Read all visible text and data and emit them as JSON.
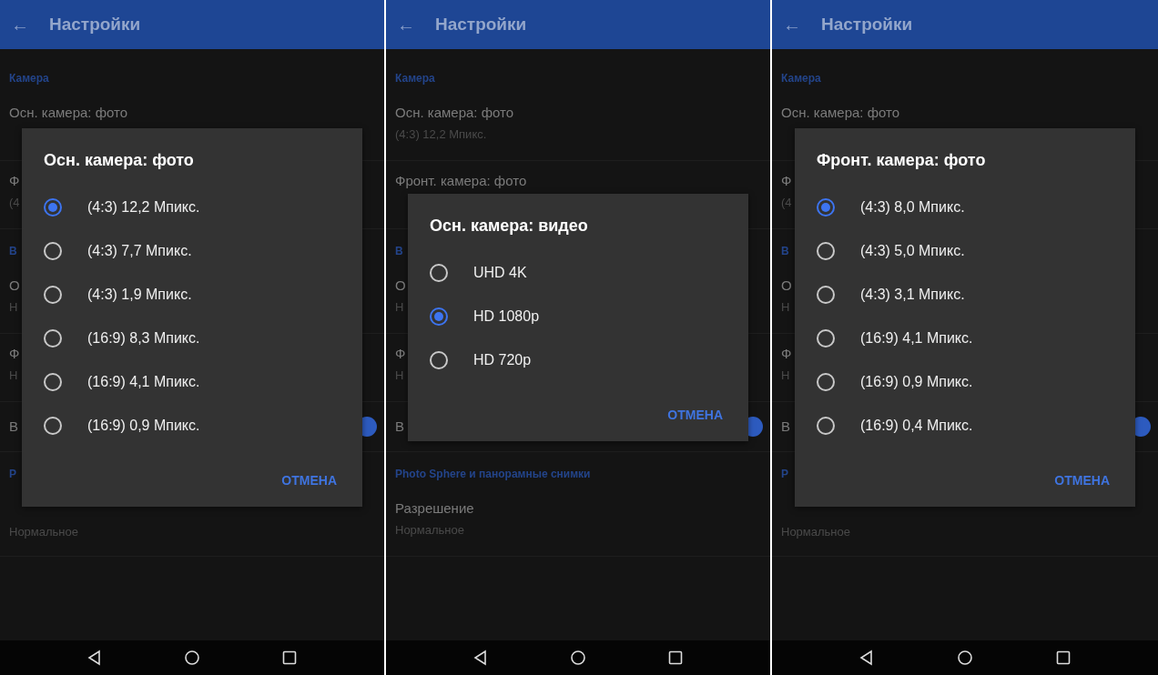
{
  "panels": [
    {
      "app_bar": {
        "back": "←",
        "title": "Настройки"
      },
      "settings": [
        {
          "kind": "header",
          "text": "Камера"
        },
        {
          "kind": "item",
          "title": "Осн. камера: фото"
        },
        {
          "kind": "item",
          "title": "Ф",
          "subtitle": "(4"
        },
        {
          "kind": "header",
          "text": "В"
        },
        {
          "kind": "item",
          "title": "О",
          "subtitle": "Н"
        },
        {
          "kind": "item",
          "title": "Ф",
          "subtitle": "Н"
        },
        {
          "kind": "switch",
          "title": "В",
          "on": true
        },
        {
          "kind": "header",
          "text": "Р"
        },
        {
          "kind": "item",
          "subtitle": "Нормальное"
        }
      ],
      "dialog": {
        "title": "Осн. камера: фото",
        "options": [
          {
            "label": "(4:3) 12,2 Мпикс.",
            "selected": true
          },
          {
            "label": "(4:3) 7,7 Мпикс.",
            "selected": false
          },
          {
            "label": "(4:3) 1,9 Мпикс.",
            "selected": false
          },
          {
            "label": "(16:9) 8,3 Мпикс.",
            "selected": false
          },
          {
            "label": "(16:9) 4,1 Мпикс.",
            "selected": false
          },
          {
            "label": "(16:9) 0,9 Мпикс.",
            "selected": false
          }
        ],
        "cancel": "ОТМЕНА"
      }
    },
    {
      "app_bar": {
        "back": "←",
        "title": "Настройки"
      },
      "settings": [
        {
          "kind": "header",
          "text": "Камера"
        },
        {
          "kind": "item",
          "title": "Осн. камера: фото",
          "subtitle": "(4:3) 12,2 Мпикс."
        },
        {
          "kind": "item",
          "title": "Фронт. камера: фото"
        },
        {
          "kind": "header",
          "text": "В"
        },
        {
          "kind": "item",
          "title": "О",
          "subtitle": "Н"
        },
        {
          "kind": "item",
          "title": "Ф",
          "subtitle": "Н"
        },
        {
          "kind": "switch",
          "title": "В",
          "on": true
        },
        {
          "kind": "header",
          "text": "Photo Sphere и панорамные снимки"
        },
        {
          "kind": "item",
          "title": "Разрешение",
          "subtitle": "Нормальное"
        }
      ],
      "dialog": {
        "title": "Осн. камера: видео",
        "options": [
          {
            "label": "UHD 4K",
            "selected": false
          },
          {
            "label": "HD 1080p",
            "selected": true
          },
          {
            "label": "HD 720p",
            "selected": false
          }
        ],
        "cancel": "ОТМЕНА"
      }
    },
    {
      "app_bar": {
        "back": "←",
        "title": "Настройки"
      },
      "settings": [
        {
          "kind": "header",
          "text": "Камера"
        },
        {
          "kind": "item",
          "title": "Осн. камера: фото"
        },
        {
          "kind": "item",
          "title": "Ф",
          "subtitle": "(4"
        },
        {
          "kind": "header",
          "text": "В"
        },
        {
          "kind": "item",
          "title": "О",
          "subtitle": "Н"
        },
        {
          "kind": "item",
          "title": "Ф",
          "subtitle": "Н"
        },
        {
          "kind": "switch",
          "title": "В",
          "on": true
        },
        {
          "kind": "header",
          "text": "Р"
        },
        {
          "kind": "item",
          "subtitle": "Нормальное"
        }
      ],
      "dialog": {
        "title": "Фронт. камера: фото",
        "options": [
          {
            "label": "(4:3) 8,0 Мпикс.",
            "selected": true
          },
          {
            "label": "(4:3) 5,0 Мпикс.",
            "selected": false
          },
          {
            "label": "(4:3) 3,1 Мпикс.",
            "selected": false
          },
          {
            "label": "(16:9) 4,1 Мпикс.",
            "selected": false
          },
          {
            "label": "(16:9) 0,9 Мпикс.",
            "selected": false
          },
          {
            "label": "(16:9) 0,4 Мпикс.",
            "selected": false
          }
        ],
        "cancel": "ОТМЕНА"
      }
    }
  ]
}
